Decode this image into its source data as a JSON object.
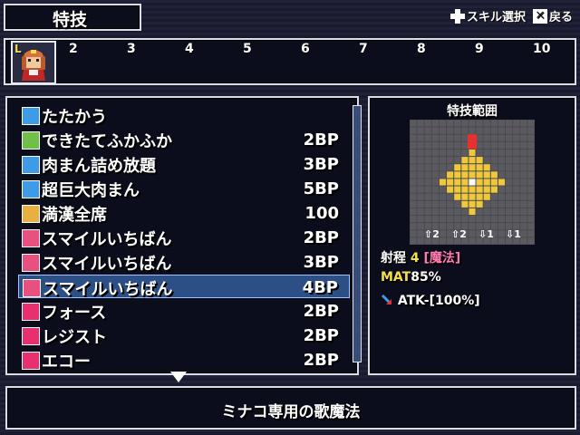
{
  "header": {
    "title": "特技",
    "hint_select": "スキル選択",
    "hint_back": "戻る"
  },
  "party": {
    "slot_numbers": [
      "2",
      "3",
      "4",
      "5",
      "6",
      "7",
      "8",
      "9",
      "10"
    ],
    "leader_marker": "L"
  },
  "skills": [
    {
      "icon": "sword-icon",
      "icon_color": "#3d9be8",
      "name": "たたかう",
      "cost": ""
    },
    {
      "icon": "plus-icon",
      "icon_color": "#6fbf48",
      "name": "できたてふかふか",
      "cost": "2BP"
    },
    {
      "icon": "item-icon",
      "icon_color": "#3d9be8",
      "name": "肉まん詰め放題",
      "cost": "3BP"
    },
    {
      "icon": "item-icon",
      "icon_color": "#3d9be8",
      "name": "超巨大肉まん",
      "cost": "5BP"
    },
    {
      "icon": "feast-icon",
      "icon_color": "#e8b040",
      "name": "満漢全席",
      "cost": "100"
    },
    {
      "icon": "music-icon",
      "icon_color": "#e85080",
      "name": "スマイルいちばん",
      "cost": "2BP"
    },
    {
      "icon": "music-plus1-icon",
      "icon_color": "#e85080",
      "name": "スマイルいちばん",
      "cost": "3BP"
    },
    {
      "icon": "music-plus2-icon",
      "icon_color": "#e85080",
      "name": "スマイルいちばん",
      "cost": "4BP"
    },
    {
      "icon": "voice-icon",
      "icon_color": "#e83070",
      "name": "フォース",
      "cost": "2BP"
    },
    {
      "icon": "voice-icon",
      "icon_color": "#e83070",
      "name": "レジスト",
      "cost": "2BP"
    },
    {
      "icon": "voice-icon",
      "icon_color": "#e83070",
      "name": "エコー",
      "cost": "2BP"
    }
  ],
  "selected_index": 7,
  "range_panel": {
    "title": "特技範囲",
    "range_label": "射程",
    "range_value": "4",
    "range_type": "[魔法]",
    "mat_label": "MAT",
    "mat_value": "85%",
    "effect": "ATK-[100%]",
    "height_markers": [
      "2",
      "2",
      "1",
      "1"
    ]
  },
  "description": "ミナコ専用の歌魔法",
  "colors": {
    "accent": "#f4e04a",
    "type_pink": "#ff7ab0",
    "selection": "#2c4f86",
    "range_fill": "#f0c83c",
    "grid_bg": "#4a4a4e"
  }
}
